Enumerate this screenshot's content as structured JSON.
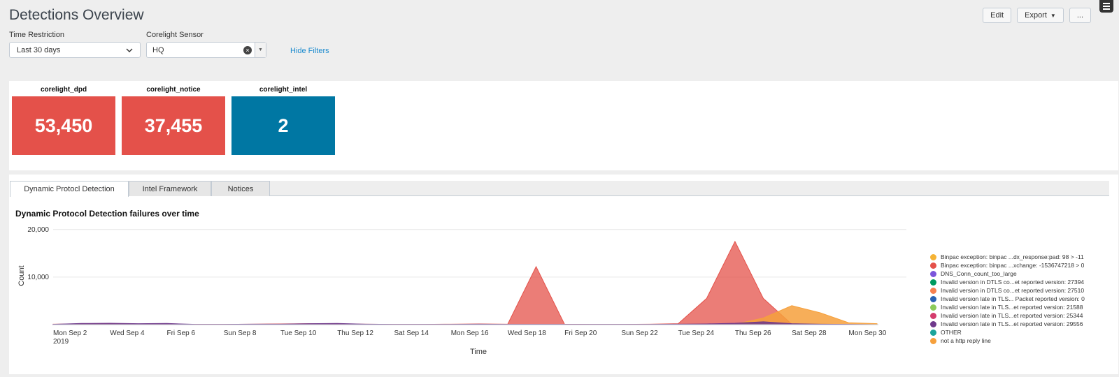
{
  "header": {
    "title": "Detections Overview",
    "edit_label": "Edit",
    "export_label": "Export",
    "more_label": "..."
  },
  "filters": {
    "time_label": "Time Restriction",
    "time_value": "Last 30 days",
    "sensor_label": "Corelight Sensor",
    "sensor_value": "HQ",
    "hide_filters_label": "Hide Filters"
  },
  "single_values": [
    {
      "label": "corelight_dpd",
      "value": "53,450",
      "color": "#e4514a"
    },
    {
      "label": "corelight_notice",
      "value": "37,455",
      "color": "#e4514a"
    },
    {
      "label": "corelight_intel",
      "value": "2",
      "color": "#0077a3"
    }
  ],
  "tabs": [
    {
      "label": "Dynamic Protocl Detection",
      "active": true
    },
    {
      "label": "Intel Framework",
      "active": false
    },
    {
      "label": "Notices",
      "active": false
    }
  ],
  "chart": {
    "title": "Dynamic Protocol Detection failures over time"
  },
  "chart_data": {
    "type": "area",
    "title": "Dynamic Protocol Detection failures over time",
    "xlabel": "Time",
    "ylabel": "Count",
    "ylim": [
      0,
      21000
    ],
    "yticks": [
      {
        "value": 10000,
        "label": "10,000"
      },
      {
        "value": 20000,
        "label": "20,000"
      }
    ],
    "x_ticks": [
      {
        "label": "Mon Sep 2",
        "sublabel": "2019"
      },
      {
        "label": "Wed Sep 4",
        "sublabel": ""
      },
      {
        "label": "Fri Sep 6",
        "sublabel": ""
      },
      {
        "label": "Sun Sep 8",
        "sublabel": ""
      },
      {
        "label": "Tue Sep 10",
        "sublabel": ""
      },
      {
        "label": "Thu Sep 12",
        "sublabel": ""
      },
      {
        "label": "Sat Sep 14",
        "sublabel": ""
      },
      {
        "label": "Mon Sep 16",
        "sublabel": ""
      },
      {
        "label": "Wed Sep 18",
        "sublabel": ""
      },
      {
        "label": "Fri Sep 20",
        "sublabel": ""
      },
      {
        "label": "Sun Sep 22",
        "sublabel": ""
      },
      {
        "label": "Tue Sep 24",
        "sublabel": ""
      },
      {
        "label": "Thu Sep 26",
        "sublabel": ""
      },
      {
        "label": "Sat Sep 28",
        "sublabel": ""
      },
      {
        "label": "Mon Sep 30",
        "sublabel": ""
      }
    ],
    "x": [
      "Sep 2",
      "Sep 3",
      "Sep 4",
      "Sep 5",
      "Sep 6",
      "Sep 7",
      "Sep 8",
      "Sep 9",
      "Sep 10",
      "Sep 11",
      "Sep 12",
      "Sep 13",
      "Sep 14",
      "Sep 15",
      "Sep 16",
      "Sep 17",
      "Sep 18",
      "Sep 19",
      "Sep 20",
      "Sep 21",
      "Sep 22",
      "Sep 23",
      "Sep 24",
      "Sep 25",
      "Sep 26",
      "Sep 27",
      "Sep 28",
      "Sep 29",
      "Sep 30",
      "Oct 1"
    ],
    "series": [
      {
        "name": "Binpac exception: binpac ...dx_response:pad: 98 > -11",
        "color": "#f5b335",
        "values": [
          0,
          0,
          0,
          0,
          0,
          0,
          0,
          0,
          0,
          0,
          0,
          0,
          0,
          0,
          0,
          0,
          0,
          0,
          0,
          0,
          0,
          0,
          0,
          0,
          0,
          0,
          0,
          0,
          0,
          0
        ]
      },
      {
        "name": "Binpac exception: binpac ...xchange: -1536747218 > 0",
        "color": "#e4514a",
        "values": [
          100,
          150,
          200,
          150,
          100,
          50,
          50,
          100,
          150,
          200,
          150,
          100,
          50,
          50,
          100,
          150,
          100,
          12200,
          100,
          50,
          50,
          100,
          200,
          5500,
          17500,
          5500,
          100,
          50,
          50,
          0
        ]
      },
      {
        "name": "DNS_Conn_count_too_large",
        "color": "#7b56db",
        "values": [
          0,
          0,
          0,
          0,
          0,
          0,
          0,
          0,
          0,
          0,
          0,
          0,
          0,
          0,
          0,
          0,
          0,
          0,
          0,
          0,
          0,
          0,
          0,
          0,
          0,
          0,
          0,
          0,
          0,
          0
        ]
      },
      {
        "name": "Invalid version in DTLS co...et reported version: 27394",
        "color": "#009a5f",
        "values": [
          0,
          0,
          0,
          0,
          0,
          0,
          0,
          0,
          0,
          0,
          0,
          0,
          0,
          0,
          0,
          0,
          0,
          0,
          0,
          0,
          0,
          0,
          0,
          0,
          0,
          0,
          0,
          0,
          0,
          0
        ]
      },
      {
        "name": "Invalid version in DTLS co...et reported version: 27510",
        "color": "#f7804f",
        "values": [
          0,
          0,
          0,
          0,
          0,
          0,
          0,
          0,
          0,
          0,
          0,
          0,
          0,
          0,
          0,
          0,
          0,
          0,
          0,
          0,
          0,
          0,
          0,
          0,
          0,
          0,
          0,
          0,
          0,
          0
        ]
      },
      {
        "name": "Invalid version late in TLS... Packet reported version: 0",
        "color": "#2a61b3",
        "values": [
          0,
          0,
          0,
          0,
          0,
          0,
          0,
          0,
          0,
          0,
          0,
          0,
          0,
          0,
          0,
          0,
          0,
          0,
          0,
          0,
          0,
          0,
          0,
          0,
          0,
          0,
          0,
          0,
          0,
          0
        ]
      },
      {
        "name": "Invalid version late in TLS...et reported version: 21588",
        "color": "#8ccb5a",
        "values": [
          0,
          0,
          0,
          0,
          0,
          0,
          0,
          0,
          0,
          0,
          0,
          0,
          0,
          0,
          0,
          0,
          0,
          0,
          0,
          0,
          0,
          0,
          0,
          0,
          0,
          0,
          0,
          0,
          0,
          0
        ]
      },
      {
        "name": "Invalid version late in TLS...et reported version: 25344",
        "color": "#d43c6d",
        "values": [
          0,
          0,
          0,
          0,
          0,
          0,
          0,
          0,
          0,
          0,
          0,
          0,
          0,
          0,
          0,
          0,
          0,
          0,
          0,
          0,
          0,
          0,
          0,
          0,
          0,
          0,
          0,
          0,
          0,
          0
        ]
      },
      {
        "name": "Invalid version late in TLS...et reported version: 29556",
        "color": "#6f3a8c",
        "values": [
          50,
          250,
          300,
          200,
          250,
          50,
          50,
          100,
          100,
          200,
          250,
          100,
          50,
          50,
          50,
          100,
          50,
          50,
          50,
          50,
          50,
          50,
          100,
          150,
          300,
          600,
          200,
          100,
          50,
          0
        ]
      },
      {
        "name": "OTHER",
        "color": "#1ba49b",
        "values": [
          0,
          0,
          0,
          0,
          0,
          0,
          0,
          0,
          0,
          0,
          0,
          0,
          0,
          0,
          0,
          0,
          0,
          0,
          0,
          0,
          0,
          0,
          0,
          0,
          0,
          0,
          0,
          0,
          0,
          0
        ]
      },
      {
        "name": "not a http reply line",
        "color": "#f6a03c",
        "values": [
          0,
          50,
          50,
          0,
          0,
          0,
          0,
          0,
          0,
          0,
          0,
          0,
          0,
          0,
          0,
          0,
          0,
          0,
          0,
          0,
          0,
          0,
          0,
          0,
          100,
          1400,
          4000,
          2500,
          400,
          200
        ]
      }
    ],
    "legend_position": "right",
    "grid": true
  }
}
